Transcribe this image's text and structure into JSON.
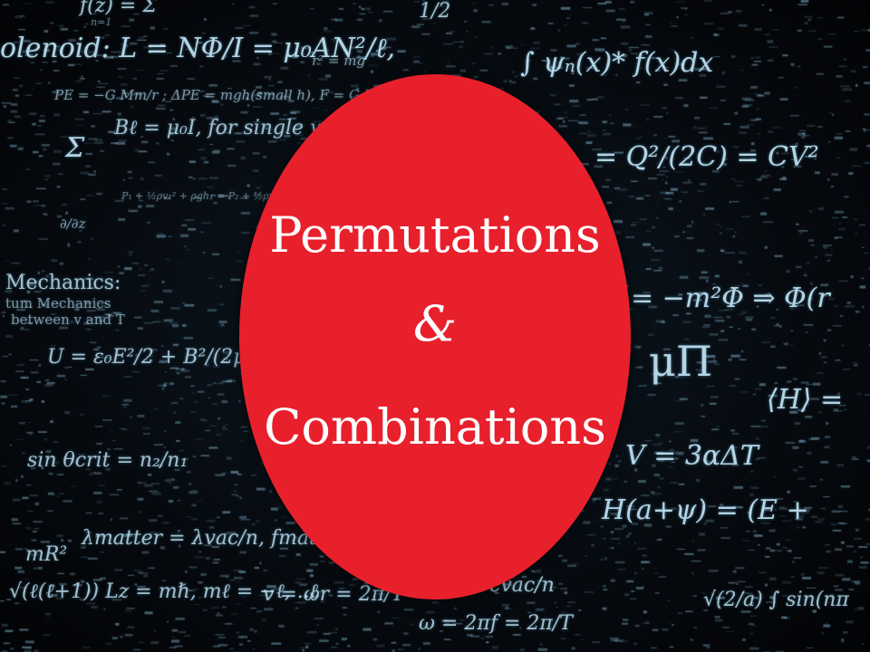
{
  "title": {
    "line1": "Permutations",
    "ampersand": "&",
    "line2": "Combinations"
  },
  "colors": {
    "badge": "#e8202c",
    "background": "#05080c",
    "equations": "#bfe0f0",
    "title_text": "#ffffff"
  },
  "background_equations": [
    "f(z) = Σ",
    "n=1",
    "1/2",
    "olenoid: L = NΦ/I = μ₀AN²/ℓ,",
    "r² = mg",
    "∫ ψₙ(x)* f(x)dx",
    "PE = −G Mm/r ; ΔPE = mgh(small h), F = G Mm/r²",
    "Bℓ = μ₀I, for single wire",
    "= Q²/(2C) = CV²",
    "Σ",
    "P₁ + ½ρv₁² + ρgh₁ = P₂ + ½ρv₂²",
    "∂/∂z",
    "Mechanics:",
    "tum Mechanics",
    "between v and T",
    "= −m²Φ ⇒ Φ(r",
    "U = ε₀E²/2 + B²/(2μ₀)",
    "μΠ",
    "⟨H⟩ =",
    "V = 3αΔT",
    "sin θcrit = n₂/n₁",
    "H(a+ψ) = (E +",
    "λmatter = λvac/n, fmatter =",
    "mR²",
    "√(ℓ(ℓ+1)) Lz = mℏ, mℓ = −ℓ, ..ℓ",
    "v = ωr = 2π/T",
    "cvac/n",
    "ω = 2πf = 2π/T",
    "√(2/a) ∫ sin(nπ"
  ]
}
